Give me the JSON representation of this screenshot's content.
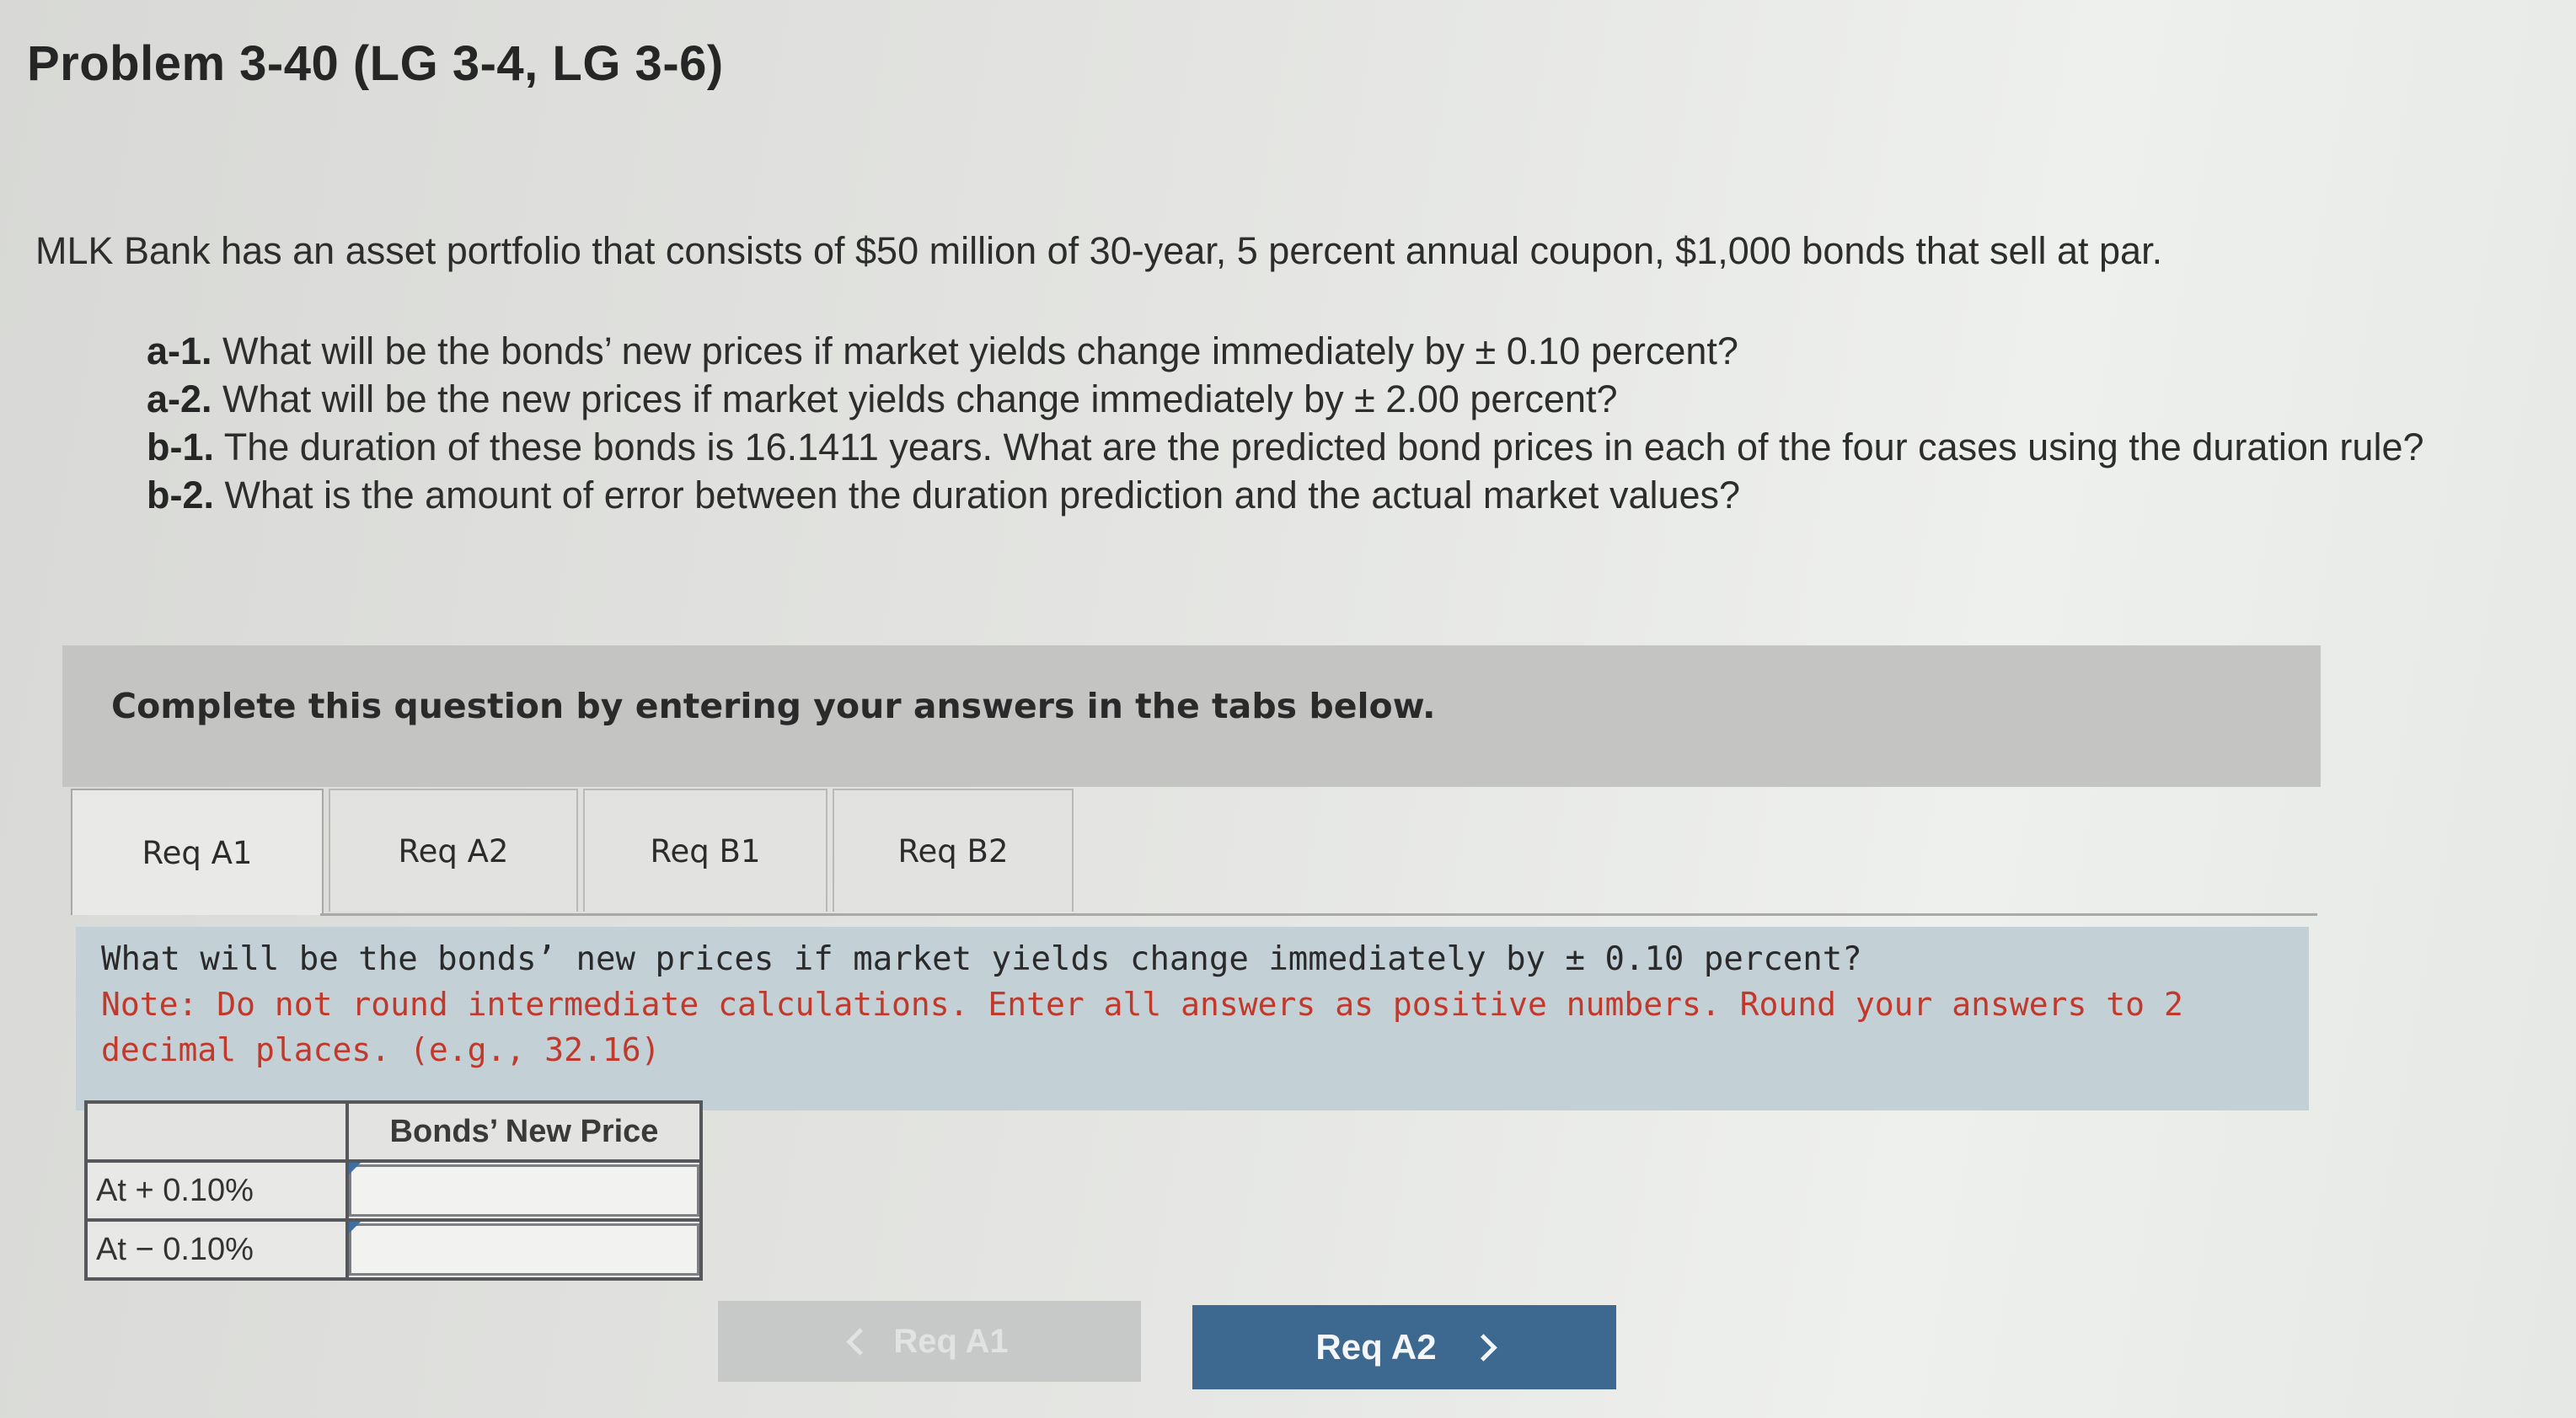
{
  "problem": {
    "title": "Problem 3-40 (LG 3-4, LG 3-6)",
    "intro": "MLK Bank has an asset portfolio that consists of $50 million of 30-year, 5 percent annual coupon, $1,000 bonds that sell at par.",
    "questions": [
      {
        "label": "a-1.",
        "text": " What will be the bonds’ new prices if market yields change immediately by ± 0.10 percent?"
      },
      {
        "label": "a-2.",
        "text": " What will be the new prices if market yields change immediately by ± 2.00 percent?"
      },
      {
        "label": "b-1.",
        "text": " The duration of these bonds is 16.1411 years. What are the predicted bond prices in each of the four cases using the duration rule?"
      },
      {
        "label": "b-2.",
        "text": " What is the amount of error between the duration prediction and the actual market values?"
      }
    ]
  },
  "instruction": "Complete this question by entering your answers in the tabs below.",
  "tabs": [
    {
      "label": "Req A1",
      "active": true
    },
    {
      "label": "Req A2",
      "active": false
    },
    {
      "label": "Req B1",
      "active": false
    },
    {
      "label": "Req B2",
      "active": false
    }
  ],
  "prompt": {
    "question": "What will be the bonds’ new prices if market yields change immediately by ± 0.10 percent?",
    "note": "Note: Do not round intermediate calculations. Enter all answers as positive numbers. Round your answers to 2 decimal places. (e.g., 32.16)"
  },
  "answer_table": {
    "column_header": "Bonds’ New Price",
    "rows": [
      {
        "label": "At + 0.10%",
        "value": ""
      },
      {
        "label": "At − 0.10%",
        "value": ""
      }
    ]
  },
  "navigation": {
    "prev_label": "Req A1",
    "next_label": "Req A2"
  },
  "colors": {
    "next_button": "#3d6890",
    "prompt_background": "#c3d0d6",
    "note_text": "#c0392b",
    "instruction_bar": "#c4c5c3"
  }
}
